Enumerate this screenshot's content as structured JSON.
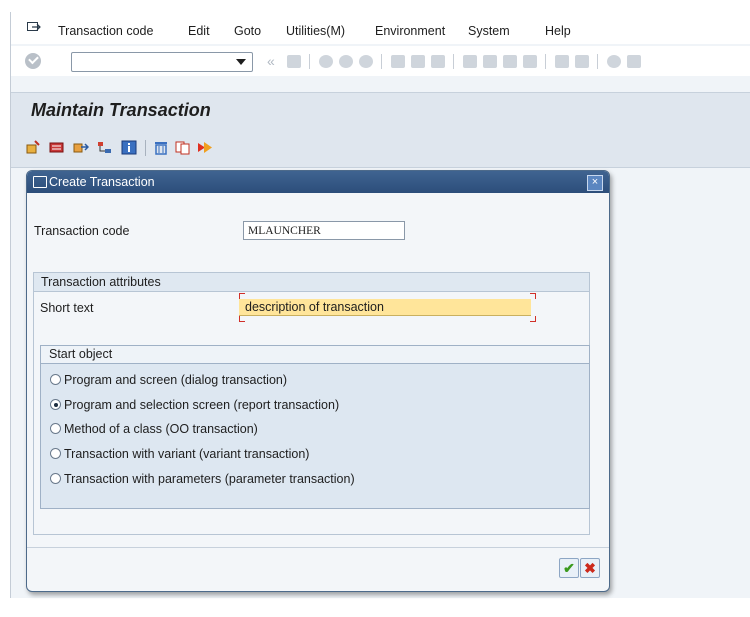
{
  "menubar": {
    "items": [
      {
        "label": "Transaction code"
      },
      {
        "label": "Edit"
      },
      {
        "label": "Goto"
      },
      {
        "label": "Utilities(M)"
      },
      {
        "label": "Environment"
      },
      {
        "label": "System"
      },
      {
        "label": "Help"
      }
    ]
  },
  "toolbar": {
    "command_value": "",
    "back_glyph": "«"
  },
  "screen": {
    "title": "Maintain Transaction"
  },
  "dialog": {
    "title": "Create Transaction",
    "close_glyph": "×",
    "transaction_code_label": "Transaction code",
    "transaction_code_value": "MLAUNCHER",
    "attributes_group": "Transaction attributes",
    "short_text_label": "Short text",
    "short_text_value": "description of transaction",
    "start_object_group": "Start object",
    "start_options": [
      {
        "label": "Program and screen (dialog transaction)",
        "selected": false
      },
      {
        "label": "Program and selection screen (report transaction)",
        "selected": true
      },
      {
        "label": "Method of a class (OO transaction)",
        "selected": false
      },
      {
        "label": "Transaction with variant (variant transaction)",
        "selected": false
      },
      {
        "label": "Transaction with parameters (parameter transaction)",
        "selected": false
      }
    ],
    "ok_glyph": "✔",
    "cancel_glyph": "✖"
  },
  "colors": {
    "dialog_title_bg": "#2c4e7a",
    "required_field_bg": "#ffe59a",
    "ok_green": "#3a9a1e",
    "cancel_red": "#cc2a1c"
  }
}
